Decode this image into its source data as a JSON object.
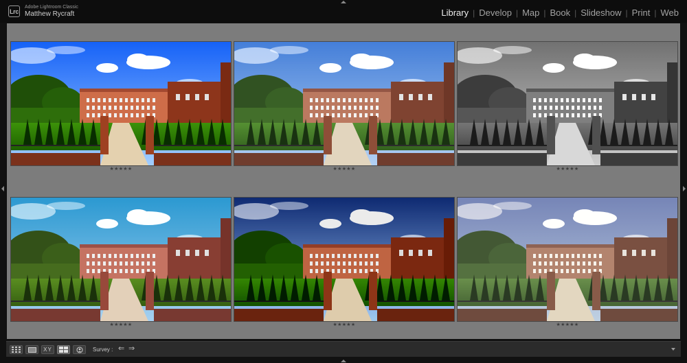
{
  "identity": {
    "badge": "Lrc",
    "product": "Adobe Lightroom Classic",
    "user": "Matthew Rycraft"
  },
  "modules": [
    {
      "label": "Library",
      "active": true
    },
    {
      "label": "Develop",
      "active": false
    },
    {
      "label": "Map",
      "active": false
    },
    {
      "label": "Book",
      "active": false
    },
    {
      "label": "Slideshow",
      "active": false
    },
    {
      "label": "Print",
      "active": false
    },
    {
      "label": "Web",
      "active": false
    }
  ],
  "module_separator": "|",
  "photos": [
    {
      "variant": "color-vivid",
      "rating": "★★★★★"
    },
    {
      "variant": "color-soft",
      "rating": "★★★★★"
    },
    {
      "variant": "black-white",
      "rating": "★★★★★"
    },
    {
      "variant": "color-cool",
      "rating": "★★★★★"
    },
    {
      "variant": "color-dramatic",
      "rating": "★★★★★"
    },
    {
      "variant": "color-faded",
      "rating": "★★★★★"
    }
  ],
  "toolbar": {
    "survey_label": "Survey :",
    "compare_label": "XY",
    "left_arrow": "⇐",
    "right_arrow": "⇒",
    "view_buttons": [
      "grid-view-icon",
      "loupe-view-icon",
      "compare-view-icon",
      "survey-view-icon",
      "people-view-icon"
    ]
  },
  "colors": {
    "background": "#7c7c7c",
    "panel": "#2b2b2b",
    "chrome": "#0d0d0d",
    "active_module": "#ececec",
    "inactive_module": "#a2a2a2"
  }
}
